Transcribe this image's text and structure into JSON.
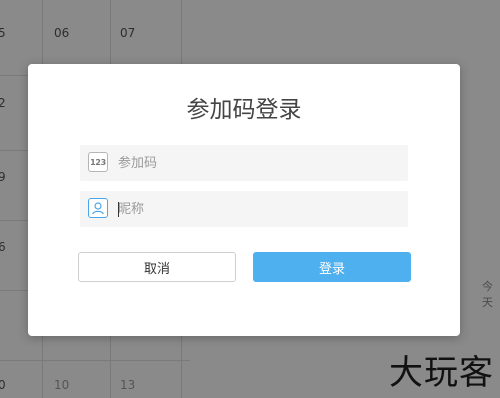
{
  "background": {
    "calendar_cells": [
      "5",
      "06",
      "07",
      "2",
      "9",
      "6",
      "0",
      "10",
      "13"
    ],
    "side_text": "今天"
  },
  "modal": {
    "title": "参加码登录",
    "code_field": {
      "icon_name": "code-123-icon",
      "icon_text": "123",
      "placeholder": "参加码",
      "value": ""
    },
    "nickname_field": {
      "icon_name": "user-icon",
      "placeholder": "昵称",
      "value": ""
    },
    "cancel_label": "取消",
    "login_label": "登录"
  },
  "watermark": "大玩客",
  "colors": {
    "overlay": "#8a8a8a",
    "primary": "#4fb0f0",
    "icon_accent": "#4aa6e8"
  }
}
